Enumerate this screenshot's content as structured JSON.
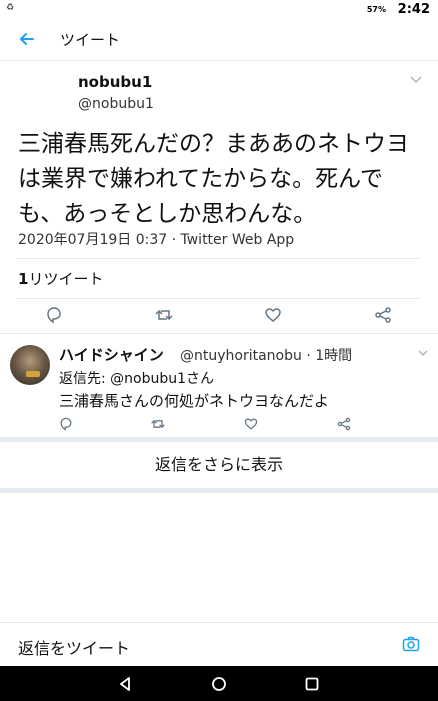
{
  "status": {
    "left": "♻",
    "battery": "57%",
    "time": "2:42"
  },
  "topbar": {
    "title": "ツイート"
  },
  "tweet": {
    "name": "nobubu1",
    "handle": "@nobubu1",
    "text": "三浦春馬死んだの？まああのネトウヨは業界で嫌われてたからな。死んでも、あっそとしか思わんな。",
    "meta": "2020年07月19日 0:37 · Twitter Web App",
    "retweet_count": "1",
    "retweet_label": "リツイート"
  },
  "reply": {
    "name": "ハイドシャイン",
    "handle": "@ntuyhoritanobu · 1時間",
    "to_prefix": "返信先: ",
    "to_user": "@nobubu1さん",
    "text": "三浦春馬さんの何処がネトウヨなんだよ"
  },
  "more_replies": "返信をさらに表示",
  "compose": {
    "label": "返信をツイート"
  },
  "colors": {
    "accent": "#1da1f2",
    "divider": "#e6ecf0",
    "icon": "#657786"
  }
}
